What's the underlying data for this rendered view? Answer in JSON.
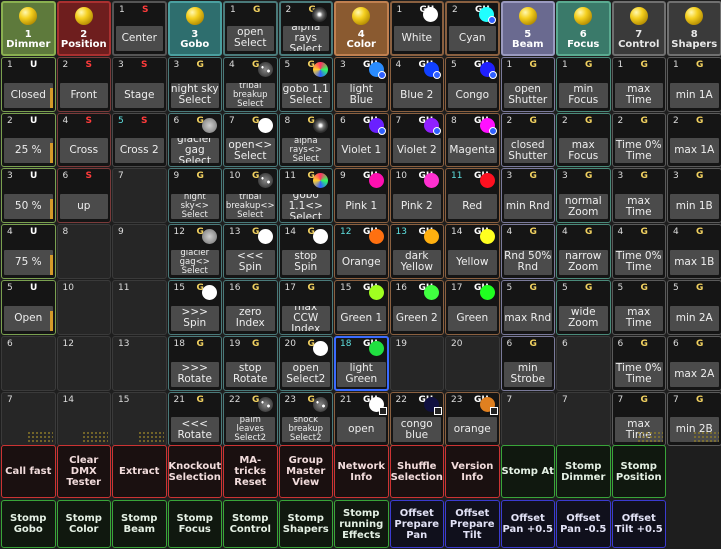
{
  "columns": [
    {
      "key": "dimmer",
      "header_number": "1",
      "header_label": "Dimmer",
      "header_bg": "#5e7a3c",
      "header_border": "#8ab050",
      "border": "#7aa050",
      "cells": [
        {
          "num": "1",
          "tag": "U",
          "label": "Closed",
          "bar": true
        },
        {
          "num": "2",
          "tag": "U",
          "label": "25 %",
          "bar": true
        },
        {
          "num": "3",
          "tag": "U",
          "label": "50 %",
          "bar": true
        },
        {
          "num": "4",
          "tag": "U",
          "label": "75 %",
          "bar": true
        },
        {
          "num": "5",
          "tag": "U",
          "label": "Open",
          "bar": true
        },
        {
          "num": "6",
          "tag": "",
          "label": ""
        },
        {
          "num": "7",
          "tag": "",
          "label": "",
          "dots": true
        }
      ]
    },
    {
      "key": "position",
      "header_number": "2",
      "header_label": "Position",
      "header_bg": "#6e1e1e",
      "header_border": "#aa3030",
      "border": "#7a3a3a",
      "cells": [
        {
          "num": "2",
          "tag": "S",
          "label": "Front"
        },
        {
          "num": "4",
          "tag": "S",
          "label": "Cross"
        },
        {
          "num": "6",
          "tag": "S",
          "label": "up"
        },
        {
          "num": "8",
          "tag": "",
          "label": ""
        },
        {
          "num": "10",
          "tag": "",
          "label": ""
        },
        {
          "num": "12",
          "tag": "",
          "label": ""
        },
        {
          "num": "14",
          "tag": "",
          "label": "",
          "dots": true
        }
      ]
    },
    {
      "key": "col3",
      "header_number": "1",
      "header_tag": "S",
      "header_label": "Center",
      "header_bg": "#151515",
      "header_border": "#555555",
      "border": "#4a4a4a",
      "cells": [
        {
          "num": "3",
          "tag": "S",
          "label": "Stage"
        },
        {
          "num": "5",
          "tag": "S",
          "label": "Cross 2",
          "numcyan": true
        },
        {
          "num": "7",
          "tag": "",
          "label": ""
        },
        {
          "num": "9",
          "tag": "",
          "label": ""
        },
        {
          "num": "11",
          "tag": "",
          "label": ""
        },
        {
          "num": "13",
          "tag": "",
          "label": ""
        },
        {
          "num": "15",
          "tag": "",
          "label": "",
          "dots": true
        }
      ]
    },
    {
      "key": "gobo",
      "header_number": "3",
      "header_label": "Gobo",
      "header_bg": "#2e6e6e",
      "header_border": "#4aa0a0",
      "border": "#4a7a7a",
      "cells": [
        {
          "num": "3",
          "tag": "G",
          "label": "night sky Select"
        },
        {
          "num": "6",
          "tag": "G",
          "label": "glacier gag Select",
          "dot": "gobo-grey"
        },
        {
          "num": "9",
          "tag": "G",
          "label": "night sky<> Select",
          "small": true
        },
        {
          "num": "12",
          "tag": "G",
          "label": "glacier gag<> Select",
          "small": true,
          "dot": "gobo-grey"
        },
        {
          "num": "15",
          "tag": "G",
          "label": ">>> Spin",
          "dot": "gobo-white"
        },
        {
          "num": "18",
          "tag": "G",
          "label": ">>> Rotate"
        },
        {
          "num": "21",
          "tag": "G",
          "label": "<<< Rotate"
        }
      ]
    },
    {
      "key": "gobo2",
      "header_number": "1",
      "header_tag": "G",
      "header_label": "open Select",
      "header_bg": "#151515",
      "header_border": "#4a7a7a",
      "border": "#4a7a7a",
      "cells": [
        {
          "num": "4",
          "tag": "G",
          "label": "tribal breakup Select",
          "small": true,
          "dot": "gobo-tribal"
        },
        {
          "num": "7",
          "tag": "G",
          "label": "open<> Select",
          "dot": "gobo-white"
        },
        {
          "num": "10",
          "tag": "G",
          "label": "tribal breakup<> Select",
          "small": true,
          "dot": "gobo-tribal"
        },
        {
          "num": "13",
          "tag": "G",
          "label": "<<< Spin",
          "dot": "gobo-white"
        },
        {
          "num": "16",
          "tag": "G",
          "label": "zero Index"
        },
        {
          "num": "19",
          "tag": "G",
          "label": "stop Rotate"
        },
        {
          "num": "22",
          "tag": "G",
          "label": "palm leaves Select2",
          "small": true,
          "dot": "gobo-tribal"
        }
      ]
    },
    {
      "key": "gobo3",
      "header_number": "2",
      "header_tag": "G",
      "header_label": "alpha rays Select",
      "header_bg": "#151515",
      "header_border": "#4a7a7a",
      "border": "#4a7a7a",
      "header_dot": "gobo-rays",
      "cells": [
        {
          "num": "5",
          "tag": "G",
          "label": "gobo 1.1 Select",
          "dot": "gobo-multi"
        },
        {
          "num": "8",
          "tag": "G",
          "label": "alpha rays<> Select",
          "small": true,
          "dot": "gobo-rays"
        },
        {
          "num": "11",
          "tag": "G",
          "label": "gobo 1.1<> Select",
          "dot": "gobo-multi"
        },
        {
          "num": "14",
          "tag": "G",
          "label": "stop Spin",
          "dot": "gobo-white"
        },
        {
          "num": "17",
          "tag": "G",
          "label": "max CCW Index"
        },
        {
          "num": "20",
          "tag": "G",
          "label": "open Select2",
          "dot": "gobo-white"
        },
        {
          "num": "23",
          "tag": "G",
          "label": "shock breakup Select2",
          "small": true,
          "dot": "gobo-tribal"
        }
      ]
    },
    {
      "key": "color",
      "header_number": "4",
      "header_label": "Color",
      "header_bg": "#8a5a30",
      "header_border": "#c08050",
      "border": "#8a6040",
      "cells": [
        {
          "num": "3",
          "tag": "GU",
          "label": "light Blue",
          "dot": "#2a8cff",
          "ring": true
        },
        {
          "num": "6",
          "tag": "GU",
          "label": "Violet 1",
          "dot": "#6a20ff",
          "ring": true
        },
        {
          "num": "9",
          "tag": "GU",
          "label": "Pink 1",
          "dot": "#ff10b0"
        },
        {
          "num": "12",
          "tag": "GU",
          "label": "Orange",
          "dot": "#ff7010",
          "numcyan": true
        },
        {
          "num": "15",
          "tag": "GU",
          "label": "Green 1",
          "dot": "#a0ff20"
        },
        {
          "num": "18",
          "tag": "GU",
          "label": "light Green",
          "dot": "#20e040",
          "selected": true,
          "numcyan": true
        },
        {
          "num": "21",
          "tag": "GU",
          "label": "open",
          "dot": "#ffffff",
          "square": true
        }
      ]
    },
    {
      "key": "color2",
      "header_number": "1",
      "header_tag": "GU",
      "header_label": "White",
      "header_bg": "#151515",
      "header_border": "#8a6040",
      "border": "#8a6040",
      "header_dot": "#ffffff",
      "cells": [
        {
          "num": "4",
          "tag": "GU",
          "label": "Blue 2",
          "dot": "#1040ff",
          "ring": true
        },
        {
          "num": "7",
          "tag": "GU",
          "label": "Violet 2",
          "dot": "#9020ff",
          "ring": true
        },
        {
          "num": "10",
          "tag": "GU",
          "label": "Pink 2",
          "dot": "#ff30d0"
        },
        {
          "num": "13",
          "tag": "GU",
          "label": "dark Yellow",
          "dot": "#ffb010",
          "numcyan": true
        },
        {
          "num": "16",
          "tag": "GU",
          "label": "Green 2",
          "dot": "#40ff40"
        },
        {
          "num": "19",
          "tag": "",
          "label": ""
        },
        {
          "num": "22",
          "tag": "GU",
          "label": "congo blue",
          "dot": "#101040",
          "square": true
        }
      ]
    },
    {
      "key": "color3",
      "header_number": "2",
      "header_tag": "GU",
      "header_label": "Cyan",
      "header_bg": "#151515",
      "header_border": "#8a6040",
      "border": "#8a6040",
      "header_dot": "#20ffff",
      "header_ring": true,
      "cells": [
        {
          "num": "5",
          "tag": "GU",
          "label": "Congo",
          "dot": "#2020ff",
          "ring": true
        },
        {
          "num": "8",
          "tag": "GU",
          "label": "Magenta",
          "dot": "#ff10ff",
          "ring": true
        },
        {
          "num": "11",
          "tag": "GU",
          "label": "Red",
          "dot": "#ff1020",
          "numcyan": true
        },
        {
          "num": "14",
          "tag": "GU",
          "label": "Yellow",
          "dot": "#ffff20"
        },
        {
          "num": "17",
          "tag": "GU",
          "label": "Green",
          "dot": "#20ff20"
        },
        {
          "num": "20",
          "tag": "",
          "label": ""
        },
        {
          "num": "23",
          "tag": "GU",
          "label": "orange",
          "dot": "#e08020",
          "square": true
        }
      ]
    },
    {
      "key": "beam",
      "header_number": "5",
      "header_label": "Beam",
      "header_bg": "#6a6a90",
      "header_border": "#9a9ac0",
      "border": "#7a7a9a",
      "cells": [
        {
          "num": "1",
          "tag": "G",
          "label": "open Shutter"
        },
        {
          "num": "2",
          "tag": "G",
          "label": "closed Shutter"
        },
        {
          "num": "3",
          "tag": "G",
          "label": "min Rnd"
        },
        {
          "num": "4",
          "tag": "G",
          "label": "Rnd 50% Rnd"
        },
        {
          "num": "5",
          "tag": "G",
          "label": "max Rnd"
        },
        {
          "num": "6",
          "tag": "G",
          "label": "min Strobe"
        },
        {
          "num": "7",
          "tag": "",
          "label": ""
        }
      ]
    },
    {
      "key": "focus",
      "header_number": "6",
      "header_label": "Focus",
      "header_bg": "#3a7a6a",
      "header_border": "#5aaa90",
      "border": "#4a8a7a",
      "cells": [
        {
          "num": "1",
          "tag": "G",
          "label": "min Focus"
        },
        {
          "num": "2",
          "tag": "G",
          "label": "max Focus"
        },
        {
          "num": "3",
          "tag": "G",
          "label": "normal Zoom"
        },
        {
          "num": "4",
          "tag": "G",
          "label": "narrow Zoom"
        },
        {
          "num": "5",
          "tag": "G",
          "label": "wide Zoom"
        },
        {
          "num": "6",
          "tag": "",
          "label": ""
        },
        {
          "num": "7",
          "tag": "",
          "label": ""
        }
      ]
    },
    {
      "key": "control",
      "header_number": "7",
      "header_label": "Control",
      "header_bg": "#3a3a3a",
      "header_border": "#707070",
      "border": "#5a5a5a",
      "cells": [
        {
          "num": "1",
          "tag": "G",
          "label": "max Time"
        },
        {
          "num": "2",
          "tag": "G",
          "label": "Time 0% Time"
        },
        {
          "num": "3",
          "tag": "G",
          "label": "max Time"
        },
        {
          "num": "4",
          "tag": "G",
          "label": "Time 0% Time"
        },
        {
          "num": "5",
          "tag": "G",
          "label": "max Time"
        },
        {
          "num": "6",
          "tag": "G",
          "label": "Time 0% Time"
        },
        {
          "num": "7",
          "tag": "G",
          "label": "max Time",
          "dots": true
        }
      ]
    },
    {
      "key": "shapers",
      "header_number": "8",
      "header_label": "Shapers",
      "header_bg": "#3a3a3a",
      "header_border": "#707070",
      "border": "#5a5a5a",
      "cells": [
        {
          "num": "1",
          "tag": "G",
          "label": "min 1A"
        },
        {
          "num": "2",
          "tag": "G",
          "label": "max 1A"
        },
        {
          "num": "3",
          "tag": "G",
          "label": "min 1B"
        },
        {
          "num": "4",
          "tag": "G",
          "label": "max 1B"
        },
        {
          "num": "5",
          "tag": "G",
          "label": "min 2A"
        },
        {
          "num": "6",
          "tag": "G",
          "label": "max 2A"
        },
        {
          "num": "7",
          "tag": "G",
          "label": "min 2B",
          "dots": true
        }
      ]
    }
  ],
  "executors_row1": [
    {
      "label": "Call fast",
      "color": "red"
    },
    {
      "label": "Clear DMX Tester",
      "color": "red"
    },
    {
      "label": "Extract",
      "color": "red"
    },
    {
      "label": "Knockout Selection",
      "color": "red"
    },
    {
      "label": "MA-tricks Reset",
      "color": "red"
    },
    {
      "label": "Group Master View",
      "color": "red"
    },
    {
      "label": "Network Info",
      "color": "red"
    },
    {
      "label": "Shuffle Selection",
      "color": "red"
    },
    {
      "label": "Version Info",
      "color": "red"
    },
    {
      "label": "Stomp At",
      "color": "green"
    },
    {
      "label": "Stomp Dimmer",
      "color": "green"
    },
    {
      "label": "Stomp Position",
      "color": "green"
    }
  ],
  "executors_row2": [
    {
      "label": "Stomp Gobo",
      "color": "green"
    },
    {
      "label": "Stomp Color",
      "color": "green"
    },
    {
      "label": "Stomp Beam",
      "color": "green"
    },
    {
      "label": "Stomp Focus",
      "color": "green"
    },
    {
      "label": "Stomp Control",
      "color": "green"
    },
    {
      "label": "Stomp Shapers",
      "color": "green"
    },
    {
      "label": "Stomp running Effects",
      "color": "green"
    },
    {
      "label": "Offset Prepare Pan",
      "color": "blue"
    },
    {
      "label": "Offset Prepare Tilt",
      "color": "blue"
    },
    {
      "label": "Offset Pan +0.5",
      "color": "blue"
    },
    {
      "label": "Offset Pan -0.5",
      "color": "blue"
    },
    {
      "label": "Offset Tilt +0.5",
      "color": "blue"
    }
  ]
}
